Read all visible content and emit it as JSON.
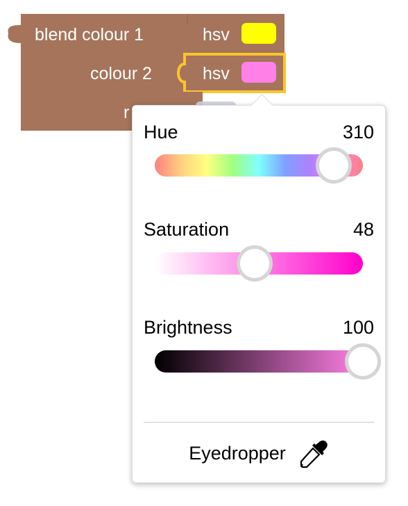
{
  "block": {
    "color": "#a5745b",
    "highlight": "#fdc42c",
    "label_blend": "blend colour 1",
    "label_colour2": "colour 2",
    "label_ratio_partial": "r",
    "field1": {
      "text": "hsv",
      "swatch": "#ffff00"
    },
    "field2": {
      "text": "hsv",
      "swatch": "#ff80e6"
    }
  },
  "picker": {
    "hue": {
      "label": "Hue",
      "value": "310",
      "fraction": 0.8611
    },
    "saturation": {
      "label": "Saturation",
      "value": "48",
      "fraction": 0.48
    },
    "brightness": {
      "label": "Brightness",
      "value": "100",
      "fraction": 1.0
    },
    "eyedropper": {
      "label": "Eyedropper",
      "icon": "eyedropper-icon"
    }
  }
}
